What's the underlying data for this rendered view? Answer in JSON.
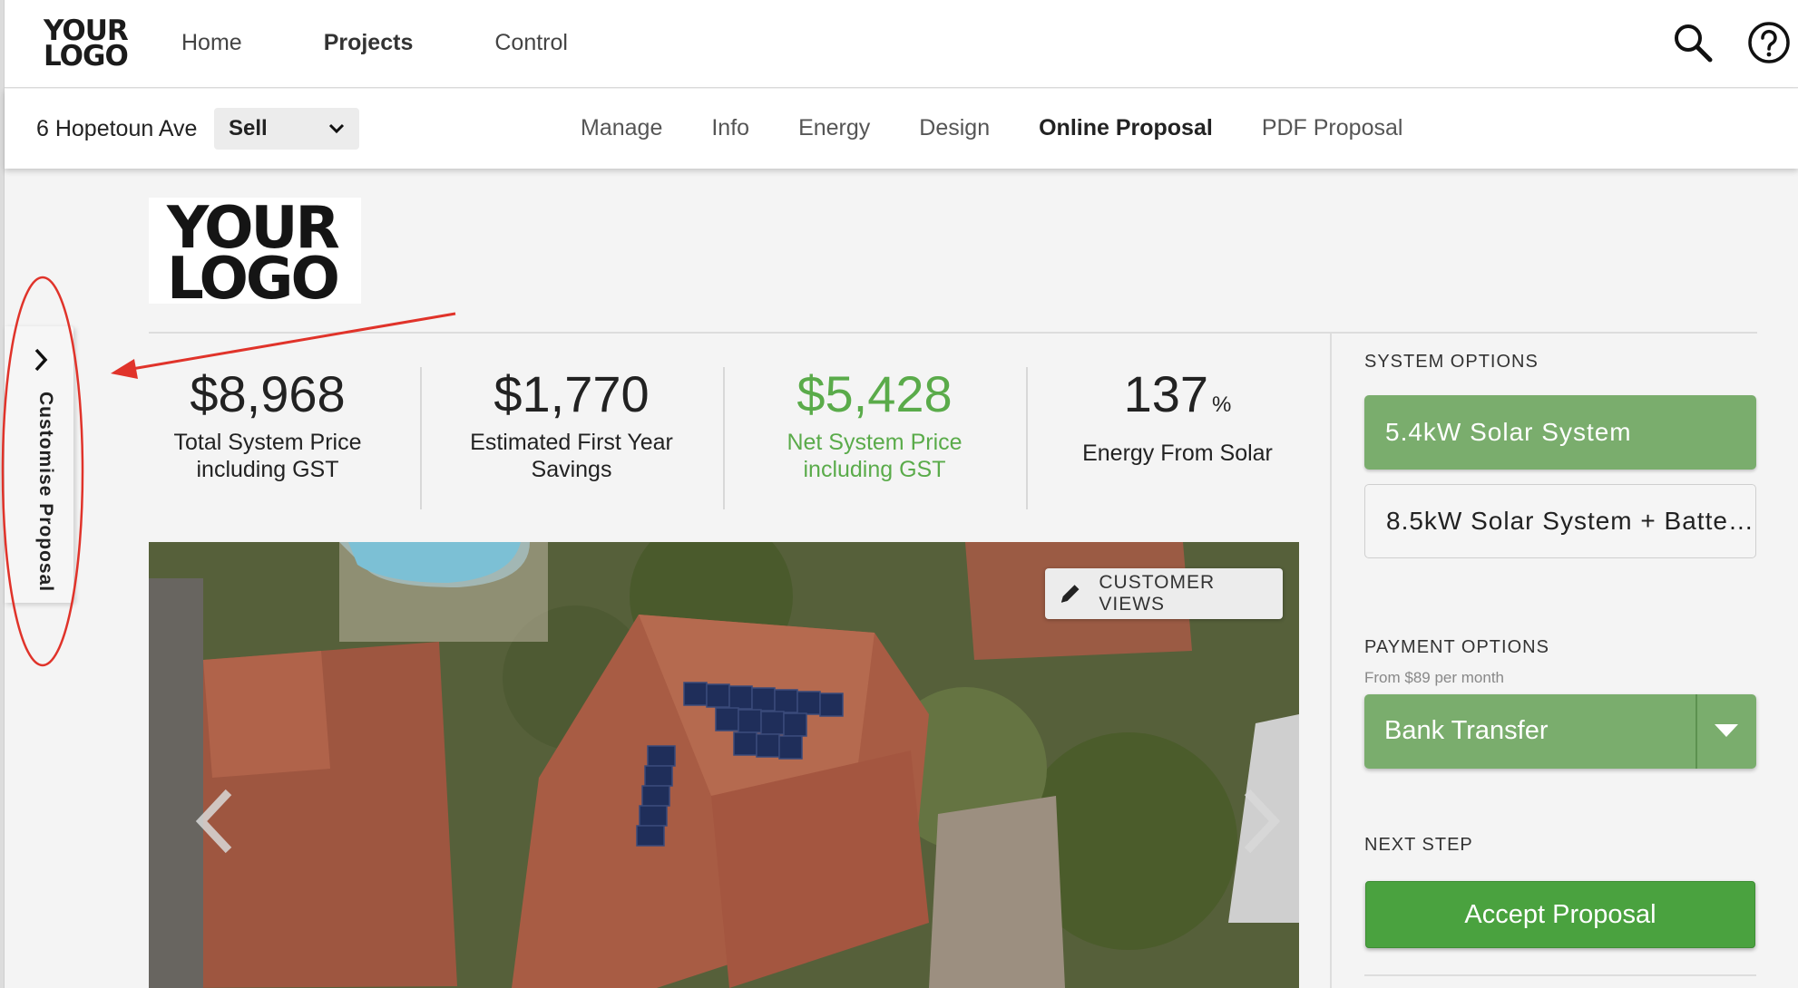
{
  "topnav": {
    "logo": "YOUR LOGO",
    "items": [
      {
        "label": "Home"
      },
      {
        "label": "Projects",
        "active": true
      },
      {
        "label": "Control"
      }
    ]
  },
  "subnav": {
    "address": "6 Hopetoun Ave",
    "mode": "Sell",
    "items": [
      {
        "label": "Manage"
      },
      {
        "label": "Info"
      },
      {
        "label": "Energy"
      },
      {
        "label": "Design"
      },
      {
        "label": "Online Proposal",
        "active": true
      },
      {
        "label": "PDF Proposal"
      }
    ]
  },
  "customise_tab": {
    "label": "Customise Proposal"
  },
  "company_logo": "YOUR LOGO",
  "stats": [
    {
      "value": "$8,968",
      "label1": "Total System Price",
      "label2": "including GST"
    },
    {
      "value": "$1,770",
      "label1": "Estimated First Year",
      "label2": "Savings"
    },
    {
      "value": "$5,428",
      "label1": "Net System Price",
      "label2": "including GST",
      "color": "#5aab4a"
    },
    {
      "value": "137",
      "unit": "%",
      "label1": "Energy From Solar"
    }
  ],
  "photo": {
    "customer_views_label": "CUSTOMER VIEWS"
  },
  "sidebar": {
    "system_options_heading": "SYSTEM OPTIONS",
    "system_options": [
      {
        "label": "5.4kW Solar System",
        "selected": true
      },
      {
        "label": "8.5kW Solar System + Batte…",
        "selected": false
      }
    ],
    "payment_heading": "PAYMENT OPTIONS",
    "payment_sub": "From $89 per month",
    "payment_selected": "Bank Transfer",
    "next_step_heading": "NEXT STEP",
    "accept_label": "Accept Proposal"
  },
  "colors": {
    "accent_green": "#7aad6d",
    "button_green": "#4aa23f",
    "price_green": "#5aab4a",
    "annotation_red": "#e0332a"
  }
}
